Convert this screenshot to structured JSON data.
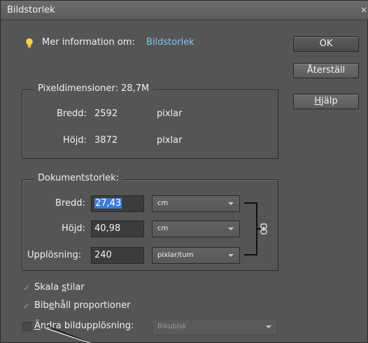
{
  "window": {
    "title": "Bildstorlek",
    "close_glyph": "×"
  },
  "info": {
    "label": "Mer information om:",
    "link": "Bildstorlek",
    "icon": "lightbulb-icon",
    "icon_color": "#f5d547"
  },
  "buttons": {
    "ok": "OK",
    "reset": "Återställ",
    "help_pre": "",
    "help_u": "H",
    "help_post": "jälp"
  },
  "pixel_dimensions": {
    "legend": "Pixeldimensioner: 28,7M",
    "width_label": "Bredd:",
    "width_value": "2592",
    "width_unit": "pixlar",
    "height_label": "Höjd:",
    "height_value": "3872",
    "height_unit": "pixlar"
  },
  "document_size": {
    "legend": "Dokumentstorlek:",
    "width_label": "Bredd:",
    "width_value": "27,43",
    "width_unit": "cm",
    "height_label": "Höjd:",
    "height_value": "40,98",
    "height_unit": "cm",
    "resolution_label": "Upplösning:",
    "resolution_value": "240",
    "resolution_unit": "pixlar/tum"
  },
  "options": {
    "scale_styles": {
      "pre": "Skala ",
      "u": "s",
      "post": "tilar",
      "checked": true
    },
    "constrain": {
      "pre": "Bib",
      "u": "e",
      "post": "håll proportioner",
      "checked": true
    },
    "resample": {
      "pre": "",
      "u": "Ä",
      "post": "ndra bildupplösning:",
      "checked": false,
      "method": "Bikubisk"
    }
  },
  "colors": {
    "accent_link": "#7fc4ef",
    "selection": "#3d7bd8",
    "panel": "#555555"
  }
}
